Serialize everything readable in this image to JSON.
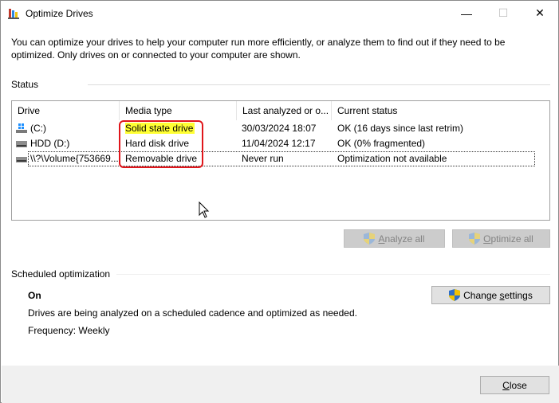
{
  "window": {
    "title": "Optimize Drives",
    "icon": "optimize-drives-icon",
    "controls": {
      "minimize": "—",
      "maximize": "☐",
      "close": "✕"
    }
  },
  "intro": "You can optimize your drives to help your computer run more efficiently, or analyze them to find out if they need to be optimized. Only drives on or connected to your computer are shown.",
  "status": {
    "label": "Status",
    "columns": [
      "Drive",
      "Media type",
      "Last analyzed or o...",
      "Current status"
    ],
    "rows": [
      {
        "icon": "windows-drive-icon",
        "drive": "(C:)",
        "media": "Solid state drive",
        "last": "30/03/2024 18:07",
        "status": "OK (16 days since last retrim)"
      },
      {
        "icon": "hard-disk-icon",
        "drive": "HDD (D:)",
        "media": "Hard disk drive",
        "last": "11/04/2024 12:17",
        "status": "OK (0% fragmented)"
      },
      {
        "icon": "removable-drive-icon",
        "drive": "\\\\?\\Volume{753669...",
        "media": "Removable drive",
        "last": "Never run",
        "status": "Optimization not available"
      }
    ],
    "buttons": {
      "analyze_pre": "",
      "analyze_u": "A",
      "analyze_post": "nalyze all",
      "optimize_pre": "",
      "optimize_u": "O",
      "optimize_post": "ptimize all"
    }
  },
  "scheduled": {
    "label": "Scheduled optimization",
    "state": "On",
    "description": "Drives are being analyzed on a scheduled cadence and optimized as needed.",
    "frequency": "Frequency: Weekly",
    "change_pre": "Change ",
    "change_u": "s",
    "change_post": "ettings"
  },
  "footer": {
    "close_u": "C",
    "close_post": "lose"
  },
  "colors": {
    "highlight": "#ffff33",
    "annotation": "#e0161b"
  }
}
